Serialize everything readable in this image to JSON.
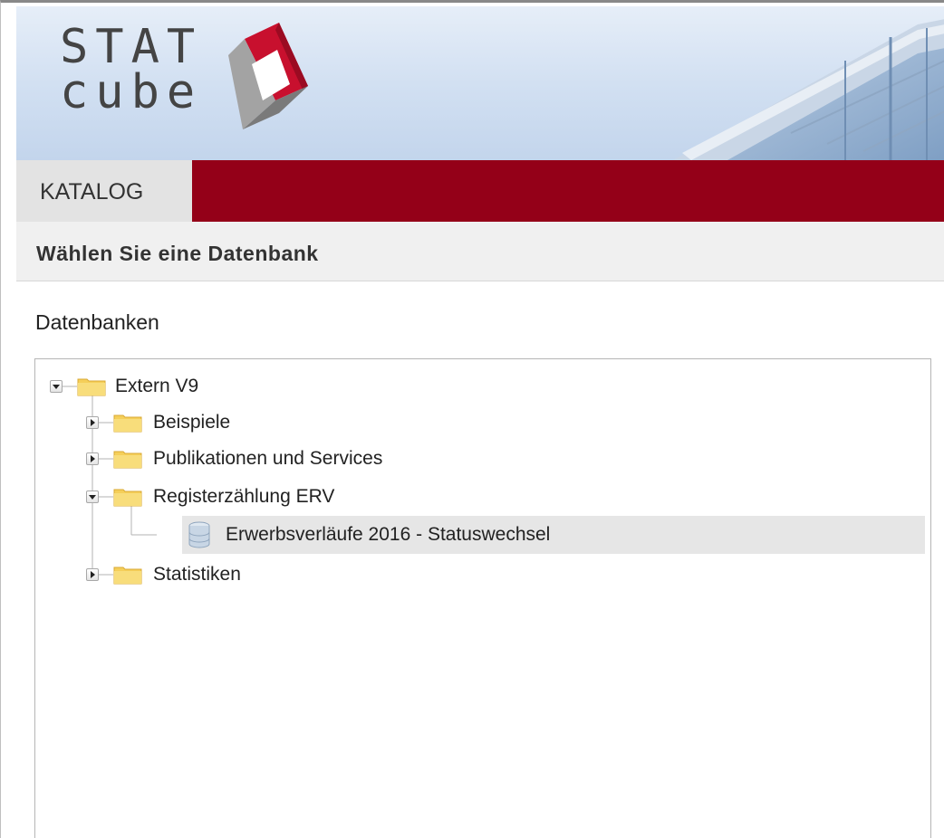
{
  "header": {
    "logo_line1": "STAT",
    "logo_line2": "cube"
  },
  "tabs": [
    {
      "label": "KATALOG",
      "active": true
    }
  ],
  "section": {
    "title": "Wählen Sie eine Datenbank"
  },
  "databases_label": "Datenbanken",
  "tree": {
    "root": {
      "label": "Extern V9",
      "expanded": true
    },
    "children": [
      {
        "label": "Beispiele",
        "expanded": false
      },
      {
        "label": "Publikationen und Services",
        "expanded": false
      },
      {
        "label": "Registerzählung ERV",
        "expanded": true,
        "children": [
          {
            "label": "Erwerbsverläufe 2016 - Statuswechsel",
            "type": "database",
            "selected": true
          }
        ]
      },
      {
        "label": "Statistiken",
        "expanded": false
      }
    ]
  },
  "colors": {
    "brand_red": "#940018",
    "tab_bg": "#e3e3e3",
    "folder": "#f5cf5a",
    "selected_row": "#e6e6e6"
  }
}
